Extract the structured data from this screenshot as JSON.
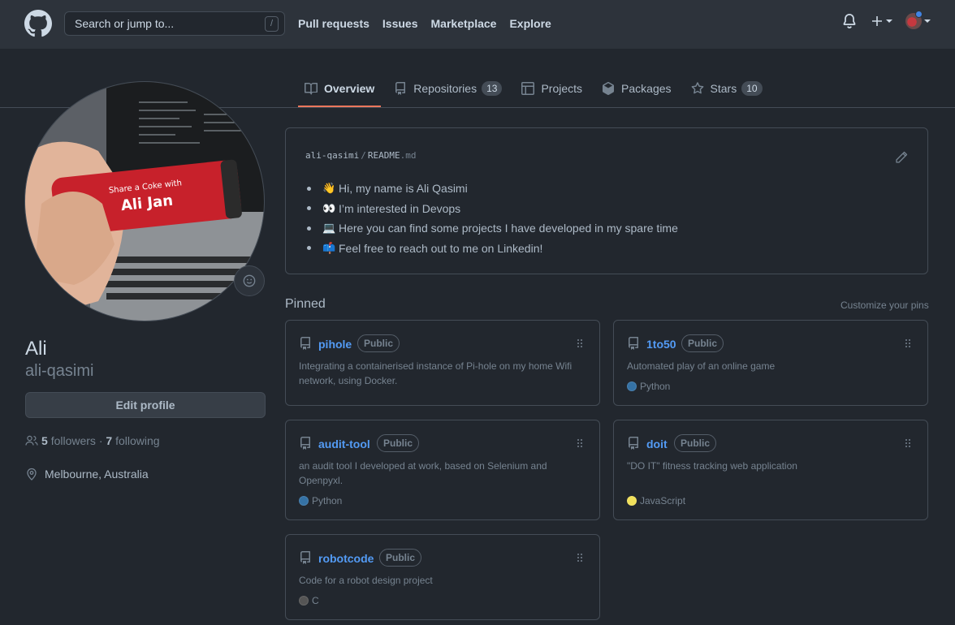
{
  "header": {
    "search_placeholder": "Search or jump to...",
    "search_shortcut": "/",
    "nav": [
      "Pull requests",
      "Issues",
      "Marketplace",
      "Explore"
    ]
  },
  "tabs": [
    {
      "label": "Overview",
      "icon": "book-icon",
      "selected": true
    },
    {
      "label": "Repositories",
      "icon": "repo-icon",
      "count": "13"
    },
    {
      "label": "Projects",
      "icon": "project-icon"
    },
    {
      "label": "Packages",
      "icon": "package-icon"
    },
    {
      "label": "Stars",
      "icon": "star-icon",
      "count": "10"
    }
  ],
  "profile": {
    "name": "Ali",
    "login": "ali-qasimi",
    "edit_label": "Edit profile",
    "followers_count": "5",
    "followers_label": "followers",
    "separator": "·",
    "following_count": "7",
    "following_label": "following",
    "location": "Melbourne, Australia",
    "avatar_can_text_1": "Share a Coke with",
    "avatar_can_text_2": "Ali Jan"
  },
  "readme": {
    "owner": "ali-qasimi",
    "sep": "/",
    "file": "README",
    "ext": ".md",
    "items": [
      {
        "emoji": "👋",
        "text": "Hi, my name is Ali Qasimi"
      },
      {
        "emoji": "👀",
        "text": "I’m interested in Devops"
      },
      {
        "emoji": "💻",
        "text": "Here you can find some projects I have developed in my spare time"
      },
      {
        "emoji": "📫",
        "text": "Feel free to reach out to me on Linkedin!"
      }
    ]
  },
  "pinned": {
    "title": "Pinned",
    "customize": "Customize your pins",
    "cards": [
      {
        "name": "pihole",
        "badge": "Public",
        "desc_1": "Integrating a containerised instance of Pi-hole on my home Wifi",
        "desc_2": "network, using Docker.",
        "lang": "",
        "lang_color": ""
      },
      {
        "name": "1to50",
        "badge": "Public",
        "desc_1": "Automated play of an online game",
        "desc_2": "",
        "lang": "Python",
        "lang_color": "#3572A5"
      },
      {
        "name": "audit-tool",
        "badge": "Public",
        "desc_1": "an audit tool I developed at work, based on Selenium and",
        "desc_2": "Openpyxl.",
        "lang": "Python",
        "lang_color": "#3572A5"
      },
      {
        "name": "doit",
        "badge": "Public",
        "desc_1": "\"DO IT\" fitness tracking web application",
        "desc_2": "",
        "lang": "JavaScript",
        "lang_color": "#f1e05a"
      },
      {
        "name": "robotcode",
        "badge": "Public",
        "desc_1": "Code for a robot design project",
        "desc_2": "",
        "lang": "C",
        "lang_color": "#555555"
      }
    ]
  }
}
